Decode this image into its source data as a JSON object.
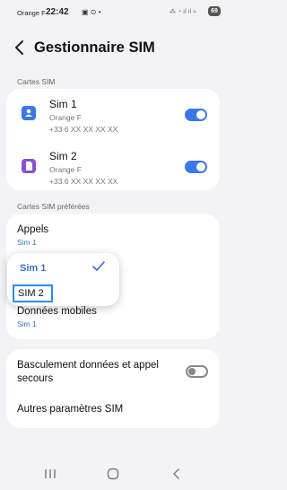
{
  "status_bar": {
    "carrier": "Orange F",
    "time": "22:42",
    "battery": "69"
  },
  "header": {
    "title": "Gestionnaire SIM"
  },
  "sim_cards": {
    "section_label": "Cartes SIM",
    "items": [
      {
        "name": "Sim 1",
        "operator": "Orange F",
        "number": "+33 6 XX XX XX XX",
        "enabled": true,
        "icon_color": "#3b78e7"
      },
      {
        "name": "Sim 2",
        "operator": "Orange F",
        "number": "+33 6 XX XX XX XX",
        "enabled": true,
        "icon_color": "#8a4fd6"
      }
    ]
  },
  "preferred": {
    "section_label": "Cartes SIM préférées",
    "calls": {
      "title": "Appels",
      "value": "Sim 1"
    },
    "data": {
      "title": "Données mobiles",
      "value": "Sim 1"
    }
  },
  "popup": {
    "options": [
      "Sim 1",
      "SIM 2"
    ],
    "selected": "Sim 1"
  },
  "backup": {
    "title_line1": "Basculement données et appel",
    "title_line2": "secours",
    "enabled": false
  },
  "other": {
    "title": "Autres paramètres SIM"
  },
  "colors": {
    "accent": "#3b78e7",
    "background": "#f3f3f5"
  }
}
